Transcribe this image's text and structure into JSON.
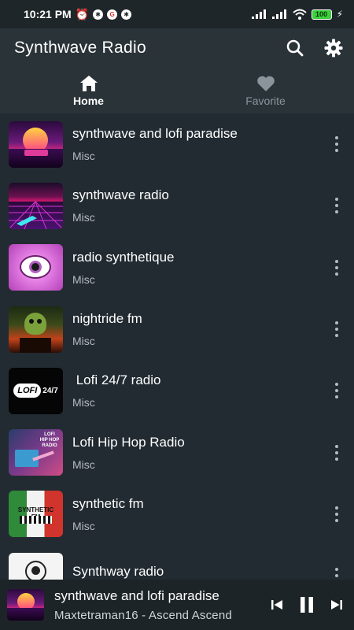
{
  "status": {
    "time": "10:21 PM",
    "battery": "100"
  },
  "app": {
    "title": "Synthwave Radio",
    "search_icon": "search-icon",
    "settings_icon": "gear-icon"
  },
  "tabs": [
    {
      "label": "Home",
      "icon": "home-icon",
      "active": true
    },
    {
      "label": "Favorite",
      "icon": "heart-icon",
      "active": false
    }
  ],
  "stations": [
    {
      "name": "synthwave and lofi paradise",
      "category": "Misc"
    },
    {
      "name": "synthwave radio",
      "category": "Misc"
    },
    {
      "name": "radio synthetique",
      "category": "Misc"
    },
    {
      "name": "nightride fm",
      "category": "Misc"
    },
    {
      "name": " Lofi 24/7 radio",
      "category": "Misc",
      "logo_text": "LOFI 24/7"
    },
    {
      "name": "Lofi Hip Hop Radio",
      "category": "Misc",
      "logo_text": "LOFI HIP HOP RADIO"
    },
    {
      "name": "synthetic fm",
      "category": "Misc",
      "logo_text": "SYNTHETIC FM"
    },
    {
      "name": "Synthway radio",
      "category": ""
    }
  ],
  "player": {
    "title": "synthwave and lofi paradise",
    "subtitle": "Maxtetraman16 - Ascend Ascend",
    "icons": [
      "skip-previous-icon",
      "pause-icon",
      "skip-next-icon"
    ]
  },
  "colors": {
    "background": "#222b31",
    "appbar": "#2a3338",
    "player": "#1d2427",
    "muted": "#8b949a"
  }
}
